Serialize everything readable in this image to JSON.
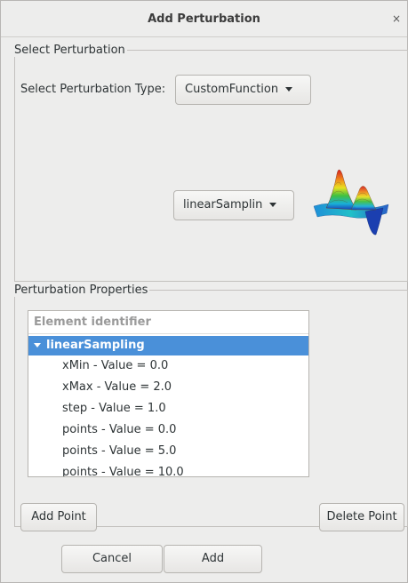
{
  "window": {
    "title": "Add Perturbation",
    "close_glyph": "×"
  },
  "select_group": {
    "legend": "Select Perturbation",
    "type_label": "Select Perturbation Type:",
    "type_value": "CustomFunction",
    "function_value": "linearSamplin",
    "preview_icon": "surface-plot-icon"
  },
  "props_group": {
    "legend": "Perturbation Properties",
    "tree": {
      "header": "Element identifier",
      "parent": "linearSampling",
      "children": [
        "xMin - Value = 0.0",
        "xMax - Value = 2.0",
        "step - Value = 1.0",
        "points - Value = 0.0",
        "points - Value = 5.0",
        "points - Value = 10.0"
      ]
    },
    "add_point_label": "Add Point",
    "delete_point_label": "Delete Point"
  },
  "footer": {
    "cancel_label": "Cancel",
    "add_label": "Add"
  },
  "colors": {
    "selection": "#4a90d9",
    "window_bg": "#ededec"
  }
}
